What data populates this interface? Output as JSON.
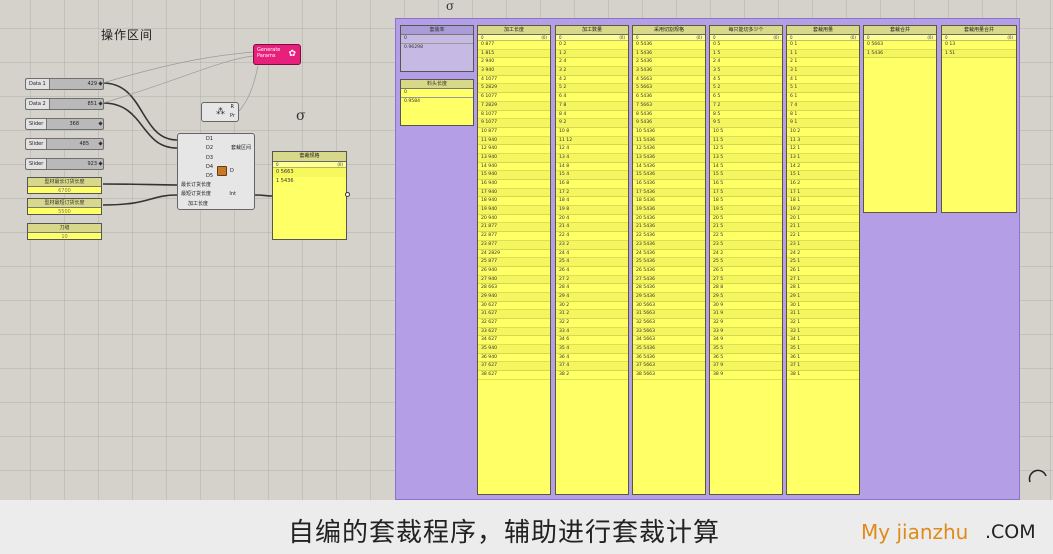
{
  "section_title": "操作区间",
  "caption": "自编的套裁程序，辅助进行套裁计算",
  "brand": {
    "left": "My jianzhu",
    "right": ".COM"
  },
  "sliders": [
    {
      "label": "Data 1",
      "value": "429"
    },
    {
      "label": "Data 2",
      "value": "851"
    },
    {
      "label": "Slider",
      "value": "368"
    },
    {
      "label": "Slider",
      "value": "485"
    },
    {
      "label": "Slider",
      "value": "923"
    }
  ],
  "param_panels": [
    {
      "title": "型材最长订货长度",
      "value": "6700"
    },
    {
      "title": "型材最短订货长度",
      "value": "5500"
    },
    {
      "title": "刀缝",
      "value": "10"
    }
  ],
  "pink_node": {
    "line1": "Generate",
    "line2": "Params"
  },
  "small_node": {
    "out1": "R",
    "out2": "Pr"
  },
  "main_comp": {
    "inputs": [
      "D1",
      "D2",
      "D3",
      "D4",
      "D5",
      "最长订货长度",
      "最短订货长度",
      "加工长度"
    ],
    "outputs": [
      "套裁区间",
      "D",
      "Int"
    ]
  },
  "output_panel": {
    "title": "套裁规格",
    "index": "0",
    "values": [
      "0 5663",
      "1 5436"
    ]
  },
  "right_small": {
    "title": "套装率",
    "index": "0",
    "value": "0.96298"
  },
  "right_small2": {
    "title": "料头长度",
    "index": "0",
    "value": "0.9584"
  },
  "columns": [
    {
      "title": "加工长度",
      "rows": [
        "0 877",
        "1 815",
        "2 940",
        "3 940",
        "4 1077",
        "5 2829",
        "6 1077",
        "7 2829",
        "8 1077",
        "9 1077",
        "10 877",
        "11 940",
        "12 940",
        "13 940",
        "14 940",
        "15 940",
        "16 940",
        "17 940",
        "18 940",
        "19 940",
        "20 940",
        "21 877",
        "22 877",
        "23 877",
        "24 2829",
        "25 877",
        "26 940",
        "27 940",
        "28 663",
        "29 940",
        "30 627",
        "31 627",
        "32 627",
        "33 627",
        "34 627",
        "35 940",
        "36 940",
        "37 627",
        "38 627"
      ]
    },
    {
      "title": "加工数量",
      "rows": [
        "0 2",
        "1 2",
        "2 4",
        "3 2",
        "4 2",
        "5 2",
        "6 4",
        "7 8",
        "8 4",
        "9 2",
        "10 8",
        "11 12",
        "12 4",
        "13 4",
        "14 8",
        "15 4",
        "16 8",
        "17 2",
        "18 4",
        "19 8",
        "20 4",
        "21 4",
        "22 4",
        "23 2",
        "24 4",
        "25 4",
        "26 4",
        "27 2",
        "28 4",
        "29 4",
        "30 2",
        "31 2",
        "32 2",
        "33 4",
        "34 6",
        "35 4",
        "36 4",
        "37 4",
        "38 2"
      ]
    },
    {
      "title": "采用切割规格",
      "rows": [
        "0 5436",
        "1 5436",
        "2 5436",
        "3 5436",
        "4 5663",
        "5 5663",
        "6 5436",
        "7 5663",
        "8 5436",
        "9 5436",
        "10 5436",
        "11 5436",
        "12 5436",
        "13 5436",
        "14 5436",
        "15 5436",
        "16 5436",
        "17 5436",
        "18 5436",
        "19 5436",
        "20 5436",
        "21 5436",
        "22 5436",
        "23 5436",
        "24 5436",
        "25 5436",
        "26 5436",
        "27 5436",
        "28 5436",
        "29 5436",
        "30 5663",
        "31 5663",
        "32 5663",
        "33 5663",
        "34 5663",
        "35 5436",
        "36 5436",
        "37 5663",
        "38 5663"
      ]
    },
    {
      "title": "每只能切多少个",
      "rows": [
        "0 5",
        "1 5",
        "2 4",
        "3 5",
        "4 5",
        "5 2",
        "6 5",
        "7 2",
        "8 5",
        "9 5",
        "10 5",
        "11 5",
        "12 5",
        "13 5",
        "14 5",
        "15 5",
        "16 5",
        "17 5",
        "18 5",
        "19 5",
        "20 5",
        "21 5",
        "22 5",
        "23 5",
        "24 2",
        "25 5",
        "26 5",
        "27 5",
        "28 8",
        "29 5",
        "30 9",
        "31 9",
        "32 9",
        "33 9",
        "34 9",
        "35 5",
        "36 5",
        "37 9",
        "38 9"
      ]
    },
    {
      "title": "套裁用量",
      "rows": [
        "0 1",
        "1 1",
        "2 1",
        "3 1",
        "4 1",
        "5 1",
        "6 1",
        "7 4",
        "8 1",
        "9 1",
        "10 2",
        "11 3",
        "12 1",
        "13 1",
        "14 2",
        "15 1",
        "16 2",
        "17 1",
        "18 1",
        "19 2",
        "20 1",
        "21 1",
        "22 1",
        "23 1",
        "24 2",
        "25 1",
        "26 1",
        "27 1",
        "28 1",
        "29 1",
        "30 1",
        "31 1",
        "32 1",
        "33 1",
        "34 1",
        "35 1",
        "36 1",
        "37 1",
        "38 1"
      ]
    },
    {
      "title": "套裁合并",
      "rows": [
        "0 5663",
        "1 5436"
      ]
    },
    {
      "title": "套裁用量合并",
      "rows": [
        "0 13",
        "1 51"
      ]
    }
  ]
}
